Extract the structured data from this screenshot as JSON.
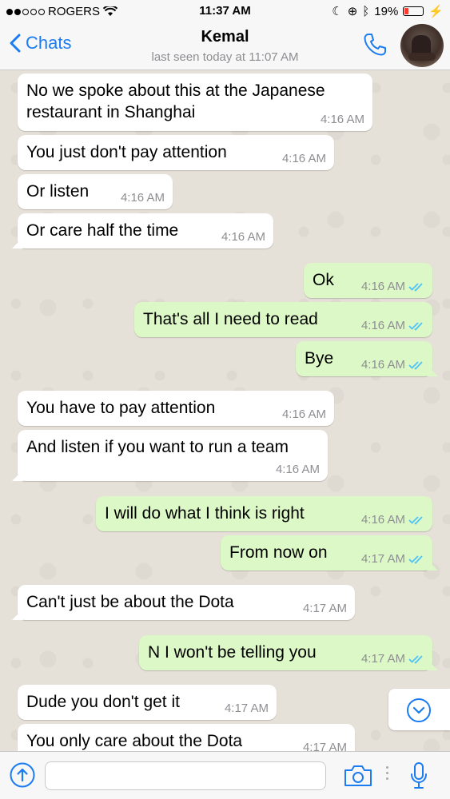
{
  "status_bar": {
    "carrier": "ROGERS",
    "time": "11:37 AM",
    "battery": "19%"
  },
  "header": {
    "back_label": "Chats",
    "contact_name": "Kemal",
    "last_seen": "last seen today at 11:07 AM"
  },
  "colors": {
    "accent": "#1b7cf2",
    "outgoing_bubble": "#dcf8c6",
    "incoming_bubble": "#ffffff",
    "read_ticks": "#4fc3f7"
  },
  "messages": [
    {
      "dir": "in",
      "text": "No we spoke about this at the Japanese\nrestaurant in Shanghai",
      "time": "4:16 AM"
    },
    {
      "dir": "in",
      "text": "You just don't pay attention",
      "time": "4:16 AM"
    },
    {
      "dir": "in",
      "text": "Or listen",
      "time": "4:16 AM"
    },
    {
      "dir": "in",
      "text": "Or care half the time",
      "time": "4:16 AM"
    },
    {
      "dir": "out",
      "text": "Ok",
      "time": "4:16 AM"
    },
    {
      "dir": "out",
      "text": "That's all I need to read",
      "time": "4:16 AM"
    },
    {
      "dir": "out",
      "text": "Bye",
      "time": "4:16 AM"
    },
    {
      "dir": "in",
      "text": "You have to pay attention",
      "time": "4:16 AM"
    },
    {
      "dir": "in",
      "text": "And listen if you want to run a team",
      "time": "4:16 AM"
    },
    {
      "dir": "out",
      "text": "I will do what I think is right",
      "time": "4:16 AM"
    },
    {
      "dir": "out",
      "text": "From now on",
      "time": "4:17 AM"
    },
    {
      "dir": "in",
      "text": "Can't just be about the Dota",
      "time": "4:17 AM"
    },
    {
      "dir": "out",
      "text": "N I won't be telling you",
      "time": "4:17 AM"
    },
    {
      "dir": "in",
      "text": "Dude you don't get it",
      "time": "4:17 AM"
    },
    {
      "dir": "in",
      "text": "You only care about the Dota",
      "time": "4:17 AM"
    }
  ],
  "input": {
    "value": "",
    "placeholder": ""
  },
  "icons": {
    "back": "chevron-left-icon",
    "call": "phone-icon",
    "scroll": "chevron-down-icon",
    "upload": "upload-icon",
    "camera": "camera-icon",
    "mic": "microphone-icon"
  }
}
